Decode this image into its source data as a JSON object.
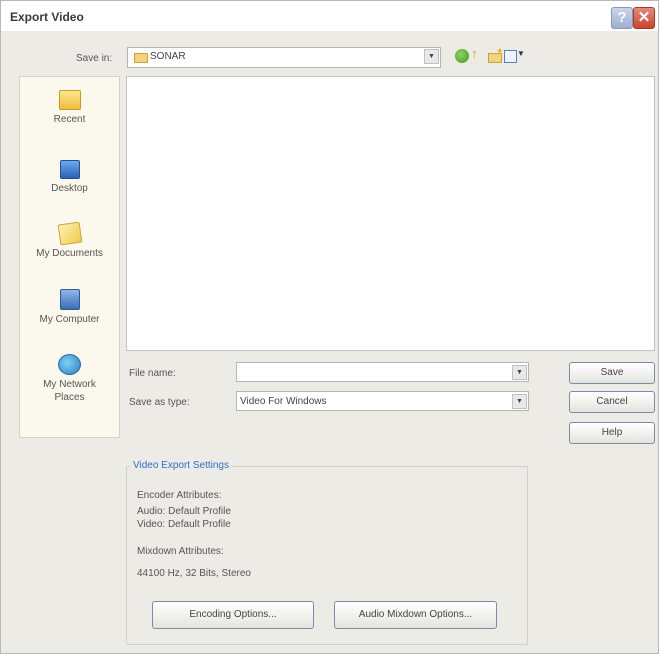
{
  "window": {
    "title": "Export Video",
    "help_glyph": "?",
    "close_glyph": "✕"
  },
  "toolbar": {
    "save_in_label": "Save in:",
    "save_in_value": "SONAR",
    "icons": [
      "back-icon",
      "up-folder-icon",
      "new-folder-icon",
      "views-menu-icon"
    ]
  },
  "places": [
    {
      "label": "Recent",
      "icon": "recent-icon"
    },
    {
      "label": "Desktop",
      "icon": "desktop-icon"
    },
    {
      "label": "My Documents",
      "icon": "my-documents-icon"
    },
    {
      "label": "My Computer",
      "icon": "my-computer-icon"
    },
    {
      "label": "My Network\nPlaces",
      "icon": "network-places-icon"
    }
  ],
  "form": {
    "file_name_label": "File name:",
    "file_name_value": "",
    "save_as_type_label": "Save as type:",
    "save_as_type_value": "Video For Windows"
  },
  "buttons": {
    "save": "Save",
    "cancel": "Cancel",
    "help": "Help"
  },
  "export_settings": {
    "title": "Video Export Settings",
    "encoder_heading": "Encoder Attributes:",
    "audio_line": "Audio: Default Profile",
    "video_line": "Video: Default Profile",
    "mixdown_heading": "Mixdown Attributes:",
    "mixdown_line": "44100 Hz, 32 Bits, Stereo",
    "encoding_options_button": "Encoding Options...",
    "audio_mixdown_button": "Audio Mixdown Options..."
  },
  "colors": {
    "dialog_bg": "#ecebe6",
    "group_title": "#2f6fc8",
    "close_red": "#c9442e"
  }
}
